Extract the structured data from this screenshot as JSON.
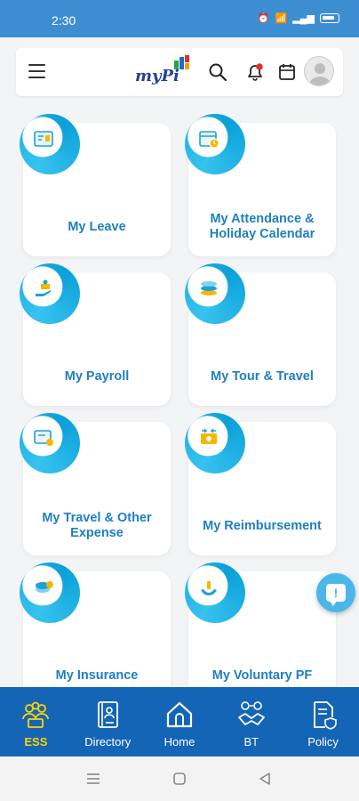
{
  "status_bar": {
    "time": "2:30"
  },
  "header": {
    "logo_text": "myPi"
  },
  "tiles": [
    {
      "label": "My Leave",
      "icon": "leave-icon"
    },
    {
      "label": "My Attendance & Holiday Calendar",
      "icon": "attendance-calendar-icon"
    },
    {
      "label": "My Payroll",
      "icon": "payroll-icon"
    },
    {
      "label": "My Tour & Travel",
      "icon": "tour-travel-icon"
    },
    {
      "label": "My Travel & Other Expense",
      "icon": "travel-expense-icon"
    },
    {
      "label": "My Reimbursement",
      "icon": "reimbursement-icon"
    },
    {
      "label": "My Insurance",
      "icon": "insurance-icon"
    },
    {
      "label": "My Voluntary PF",
      "icon": "voluntary-pf-icon"
    }
  ],
  "help_button": {
    "glyph": "!"
  },
  "bottom_nav": [
    {
      "label": "ESS",
      "active": true
    },
    {
      "label": "Directory",
      "active": false
    },
    {
      "label": "Home",
      "active": false
    },
    {
      "label": "BT",
      "active": false
    },
    {
      "label": "Policy",
      "active": false
    }
  ],
  "colors": {
    "primary": "#1565b6",
    "accent": "#0aa1d8",
    "active_nav": "#ffd400",
    "status_bar": "#3d8ed1"
  }
}
